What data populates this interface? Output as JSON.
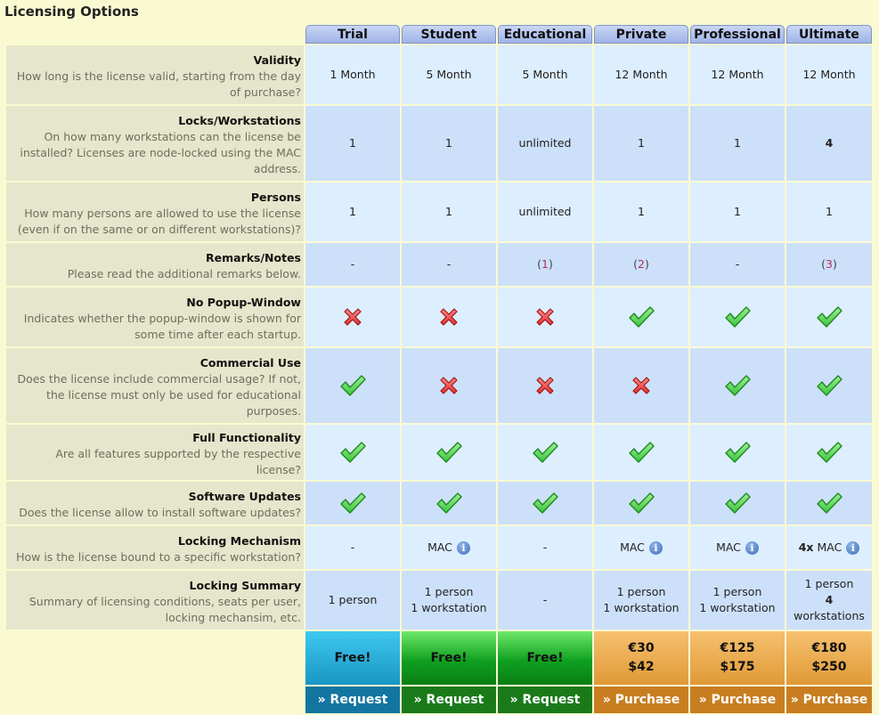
{
  "page_title": "Licensing Options",
  "plans": [
    {
      "name": "Trial",
      "price_line1": "Free!",
      "price_line2": "",
      "action": "» Request",
      "theme": "blue"
    },
    {
      "name": "Student",
      "price_line1": "Free!",
      "price_line2": "",
      "action": "» Request",
      "theme": "green"
    },
    {
      "name": "Educational",
      "price_line1": "Free!",
      "price_line2": "",
      "action": "» Request",
      "theme": "green"
    },
    {
      "name": "Private",
      "price_line1": "€30",
      "price_line2": "$42",
      "action": "» Purchase",
      "theme": "orange"
    },
    {
      "name": "Professional",
      "price_line1": "€125",
      "price_line2": "$175",
      "action": "» Purchase",
      "theme": "orange"
    },
    {
      "name": "Ultimate",
      "price_line1": "€180",
      "price_line2": "$250",
      "action": "» Purchase",
      "theme": "orange"
    }
  ],
  "colors": {
    "check": "#3cc43c",
    "cross": "#e03030",
    "info": "#3f6fb8",
    "note": "#b03060"
  },
  "rows": [
    {
      "key": "validity",
      "name": "Validity",
      "desc": "How long is the license valid, starting from the day of purchase?",
      "cells": [
        {
          "type": "text",
          "text": "1 Month"
        },
        {
          "type": "text",
          "text": "5 Month"
        },
        {
          "type": "text",
          "text": "5 Month"
        },
        {
          "type": "text",
          "text": "12 Month"
        },
        {
          "type": "text",
          "text": "12 Month"
        },
        {
          "type": "text",
          "text": "12 Month"
        }
      ]
    },
    {
      "key": "locks",
      "name": "Locks/Workstations",
      "desc": "On how many workstations can the license be installed? Licenses are node-locked using the MAC address.",
      "cells": [
        {
          "type": "text",
          "text": "1"
        },
        {
          "type": "text",
          "text": "1"
        },
        {
          "type": "text",
          "text": "unlimited"
        },
        {
          "type": "text",
          "text": "1"
        },
        {
          "type": "text",
          "text": "1"
        },
        {
          "type": "bold",
          "text": "4"
        }
      ]
    },
    {
      "key": "persons",
      "name": "Persons",
      "desc": "How many persons are allowed to use the license (even if on the same or on different workstations)?",
      "cells": [
        {
          "type": "text",
          "text": "1"
        },
        {
          "type": "text",
          "text": "1"
        },
        {
          "type": "text",
          "text": "unlimited"
        },
        {
          "type": "text",
          "text": "1"
        },
        {
          "type": "text",
          "text": "1"
        },
        {
          "type": "text",
          "text": "1"
        }
      ]
    },
    {
      "key": "remarks",
      "name": "Remarks/Notes",
      "desc": "Please read the additional remarks below.",
      "cells": [
        {
          "type": "text",
          "text": "-"
        },
        {
          "type": "text",
          "text": "-"
        },
        {
          "type": "note",
          "text": "1"
        },
        {
          "type": "note",
          "text": "2"
        },
        {
          "type": "text",
          "text": "-"
        },
        {
          "type": "note",
          "text": "3"
        }
      ]
    },
    {
      "key": "nopopup",
      "name": "No Popup-Window",
      "desc": "Indicates whether the popup-window is shown for some time after each startup.",
      "cells": [
        {
          "type": "cross"
        },
        {
          "type": "cross"
        },
        {
          "type": "cross"
        },
        {
          "type": "check"
        },
        {
          "type": "check"
        },
        {
          "type": "check"
        }
      ]
    },
    {
      "key": "commercial",
      "name": "Commercial Use",
      "desc": "Does the license include commercial usage? If not, the license must only be used for educational purposes.",
      "cells": [
        {
          "type": "check"
        },
        {
          "type": "cross"
        },
        {
          "type": "cross"
        },
        {
          "type": "cross"
        },
        {
          "type": "check"
        },
        {
          "type": "check"
        }
      ]
    },
    {
      "key": "fullfunc",
      "name": "Full Functionality",
      "desc": "Are all features supported by the respective license?",
      "cells": [
        {
          "type": "check"
        },
        {
          "type": "check"
        },
        {
          "type": "check"
        },
        {
          "type": "check"
        },
        {
          "type": "check"
        },
        {
          "type": "check"
        }
      ]
    },
    {
      "key": "updates",
      "name": "Software Updates",
      "desc": "Does the license allow to install software updates?",
      "cells": [
        {
          "type": "check"
        },
        {
          "type": "check"
        },
        {
          "type": "check"
        },
        {
          "type": "check"
        },
        {
          "type": "check"
        },
        {
          "type": "check"
        }
      ]
    },
    {
      "key": "locking",
      "name": "Locking Mechanism",
      "desc": "How is the license bound to a specific workstation?",
      "cells": [
        {
          "type": "text",
          "text": "-"
        },
        {
          "type": "mac",
          "prefix": "",
          "text": "MAC"
        },
        {
          "type": "text",
          "text": "-"
        },
        {
          "type": "mac",
          "prefix": "",
          "text": "MAC"
        },
        {
          "type": "mac",
          "prefix": "",
          "text": "MAC"
        },
        {
          "type": "mac",
          "prefix": "4x",
          "text": "MAC"
        }
      ]
    },
    {
      "key": "summary",
      "name": "Locking Summary",
      "desc": "Summary of licensing conditions, seats per user, locking mechansim, etc.",
      "cells": [
        {
          "type": "lines",
          "lines": [
            "1 person"
          ]
        },
        {
          "type": "lines",
          "lines": [
            "1 person",
            "1 workstation"
          ]
        },
        {
          "type": "text",
          "text": "-"
        },
        {
          "type": "lines",
          "lines": [
            "1 person",
            "1 workstation"
          ]
        },
        {
          "type": "lines",
          "lines": [
            "1 person",
            "1 workstation"
          ]
        },
        {
          "type": "lines",
          "lines": [
            "1 person",
            "4",
            "workstations"
          ],
          "bold_index": 1
        }
      ]
    }
  ]
}
